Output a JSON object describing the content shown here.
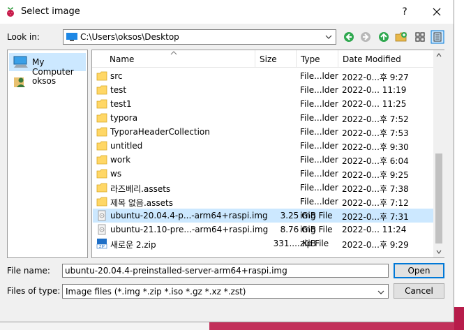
{
  "window": {
    "title": "Select image",
    "help": "?"
  },
  "lookin": {
    "label": "Look in:",
    "path": "C:\\Users\\oksos\\Desktop"
  },
  "sidebar": {
    "items": [
      {
        "label": "My Computer",
        "icon": "computer-icon",
        "selected": true
      },
      {
        "label": "oksos",
        "icon": "user-folder-icon",
        "selected": false
      }
    ]
  },
  "columns": {
    "name": "Name",
    "size": "Size",
    "type": "Type",
    "date": "Date Modified"
  },
  "files": [
    {
      "name": "src",
      "size": "",
      "type": "File...lder",
      "date": "2022-0...후 9:27",
      "icon": "folder-icon"
    },
    {
      "name": "test",
      "size": "",
      "type": "File...lder",
      "date": "2022-0... 11:19",
      "icon": "folder-icon"
    },
    {
      "name": "test1",
      "size": "",
      "type": "File...lder",
      "date": "2022-0... 11:25",
      "icon": "folder-icon"
    },
    {
      "name": "typora",
      "size": "",
      "type": "File...lder",
      "date": "2022-0...후 7:52",
      "icon": "folder-icon"
    },
    {
      "name": "TyporaHeaderCollection",
      "size": "",
      "type": "File...lder",
      "date": "2022-0...후 7:53",
      "icon": "folder-icon"
    },
    {
      "name": "untitled",
      "size": "",
      "type": "File...lder",
      "date": "2022-0...후 9:30",
      "icon": "folder-icon"
    },
    {
      "name": "work",
      "size": "",
      "type": "File...lder",
      "date": "2022-0...후 6:04",
      "icon": "folder-icon"
    },
    {
      "name": "ws",
      "size": "",
      "type": "File...lder",
      "date": "2022-0...후 9:25",
      "icon": "folder-icon"
    },
    {
      "name": "라즈베리.assets",
      "size": "",
      "type": "File...lder",
      "date": "2022-0...후 7:38",
      "icon": "folder-icon"
    },
    {
      "name": "제목 없음.assets",
      "size": "",
      "type": "File...lder",
      "date": "2022-0...후 7:12",
      "icon": "folder-icon"
    },
    {
      "name": "ubuntu-20.04.4-p...-arm64+raspi.img",
      "size": "3.25 GiB",
      "type": "img File",
      "date": "2022-0...후 7:31",
      "icon": "disk-image-icon",
      "selected": true
    },
    {
      "name": "ubuntu-21.10-pre...-arm64+raspi.img",
      "size": "8.76 GiB",
      "type": "img File",
      "date": "2022-0... 11:24",
      "icon": "disk-image-icon"
    },
    {
      "name": "새로운 2.zip",
      "size": "331.... KiB",
      "type": "zip File",
      "date": "2022-0...후 9:29",
      "icon": "zip-icon"
    }
  ],
  "filename": {
    "label": "File name:",
    "value": "ubuntu-20.04.4-preinstalled-server-arm64+raspi.img"
  },
  "filetype": {
    "label": "Files of type:",
    "value": "Image files (*.img *.zip *.iso *.gz *.xz *.zst)"
  },
  "buttons": {
    "open": "Open",
    "cancel": "Cancel"
  },
  "colors": {
    "selection": "#cce8ff",
    "accent": "#0078d7",
    "folder": "#ffd766"
  }
}
